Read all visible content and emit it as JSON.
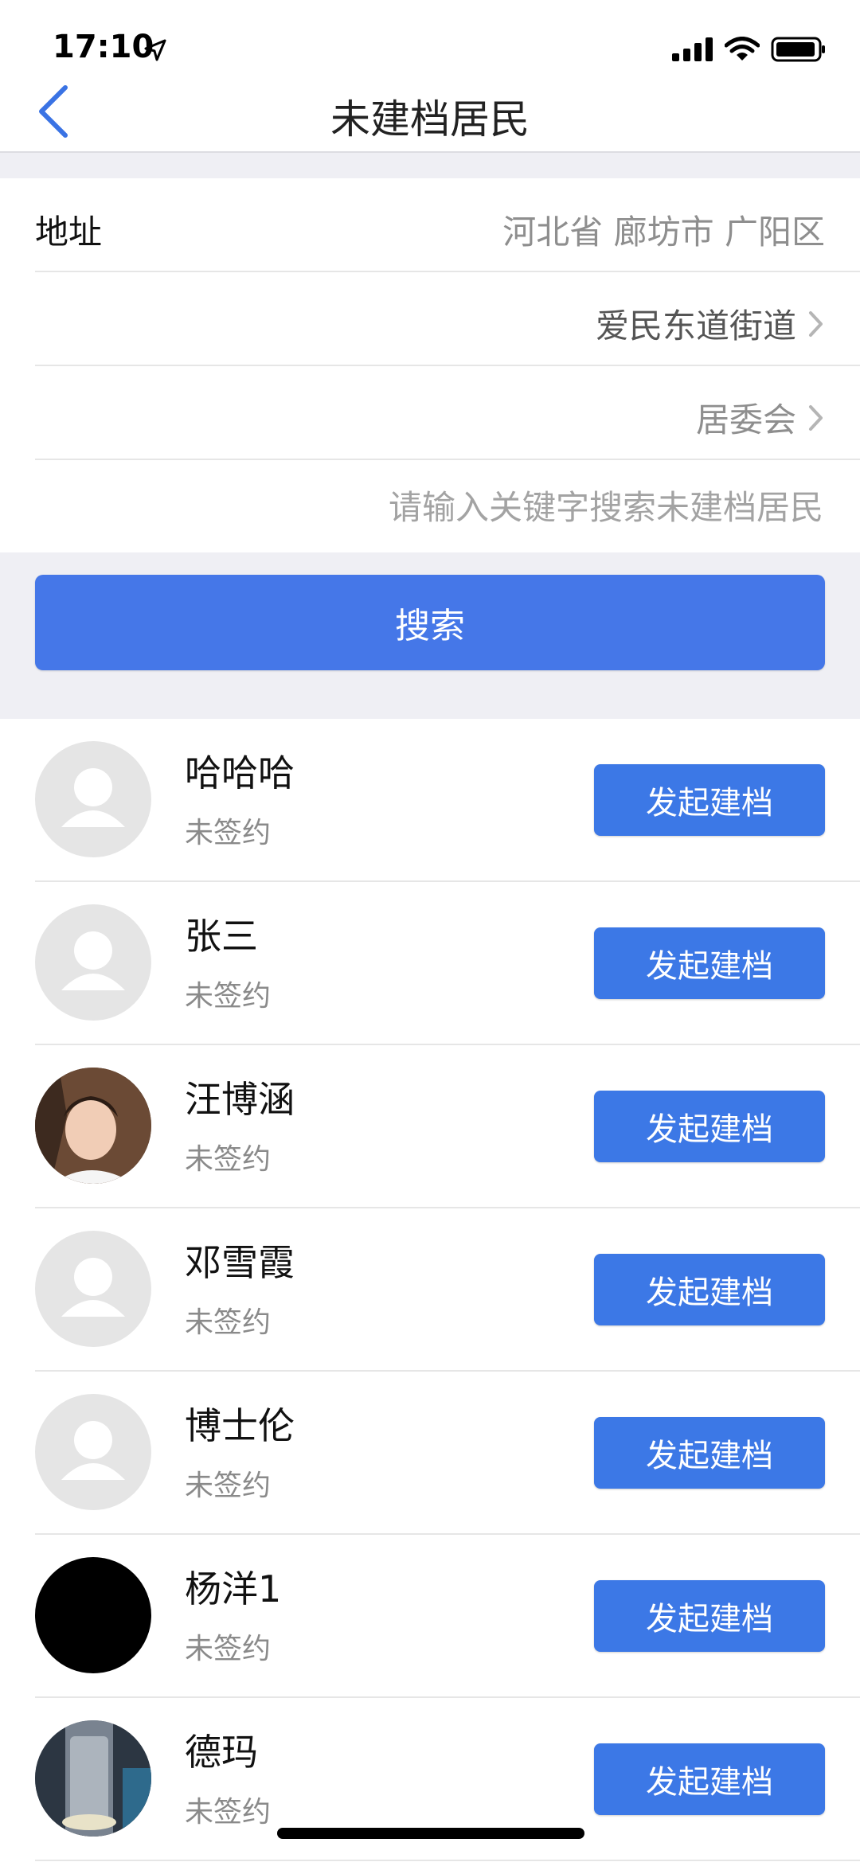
{
  "status_bar": {
    "time": "17:10",
    "location_icon": "location-arrow-icon",
    "signal_icon": "cellular-signal-icon",
    "wifi_icon": "wifi-icon",
    "battery_icon": "battery-icon"
  },
  "nav": {
    "title": "未建档居民",
    "back_icon": "chevron-left-icon"
  },
  "form": {
    "address_label": "地址",
    "address_value": "河北省 廊坊市 广阳区",
    "street_value": "爱民东道街道",
    "committee_value": "居委会",
    "search_placeholder": "请输入关键字搜索未建档居民"
  },
  "search_button": "搜索",
  "residents": [
    {
      "name": "哈哈哈",
      "status": "未签约",
      "action": "发起建档"
    },
    {
      "name": "张三",
      "status": "未签约",
      "action": "发起建档"
    },
    {
      "name": "汪博涵",
      "status": "未签约",
      "action": "发起建档"
    },
    {
      "name": "邓雪霞",
      "status": "未签约",
      "action": "发起建档"
    },
    {
      "name": "博士伦",
      "status": "未签约",
      "action": "发起建档"
    },
    {
      "name": "杨洋1",
      "status": "未签约",
      "action": "发起建档"
    },
    {
      "name": "德玛",
      "status": "未签约",
      "action": "发起建档"
    }
  ],
  "colors": {
    "accent": "#4577e8",
    "button": "#3c78e6",
    "background_band": "#efeff4"
  }
}
